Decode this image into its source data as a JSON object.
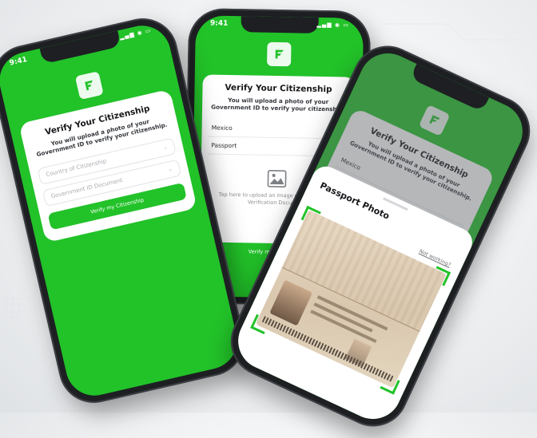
{
  "colors": {
    "brand_green": "#22c229",
    "card_white": "#ffffff",
    "phone_frame": "#1d1f22"
  },
  "status_bar": {
    "time": "9:41"
  },
  "phone1": {
    "title": "Verify Your Citizenship",
    "subtitle": "You will upload a photo of your Government ID to verify your citizenship.",
    "country_placeholder": "Country of Citizenship",
    "document_placeholder": "Government ID Document",
    "button_label": "Verify my Citizenship"
  },
  "phone2": {
    "title": "Verify Your Citizenship",
    "subtitle": "You will upload a photo of your Government ID to verify your citizenship.",
    "country_value": "Mexico",
    "document_value": "Passport",
    "upload_text": "Tap here to upload an image of your Identity Verification Document",
    "button_label": "Verify my Citizenship"
  },
  "phone3": {
    "sheet_title": "Passport Photo",
    "not_working_link": "Not working?",
    "background_title": "Verify Your Citizenship",
    "background_subtitle": "You will upload a photo of your Government ID to verify your citizenship.",
    "background_field": "Mexico"
  },
  "icons": {
    "logo": "brand-f-logo-icon",
    "chevron": "chevron-down-icon",
    "image_upload": "image-icon"
  }
}
